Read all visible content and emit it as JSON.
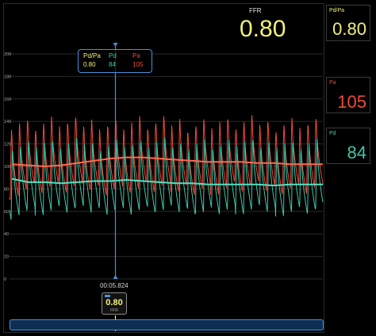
{
  "ffr": {
    "label": "FFR",
    "value": "0.80"
  },
  "panels": {
    "pdpa": {
      "label": "Pd/Pa",
      "value": "0.80",
      "color": "#f3f07a"
    },
    "pa": {
      "label": "Pa",
      "value": "105",
      "color": "#f04a3a"
    },
    "pd": {
      "label": "Pd",
      "value": "84",
      "color": "#3ec8a8"
    }
  },
  "tooltip": {
    "pdpa_label": "Pd/Pa",
    "pdpa_value": "0.80",
    "pd_label": "Pd",
    "pd_value": "84",
    "pa_label": "Pa",
    "pa_value": "105"
  },
  "cursor": {
    "time": "00:05.824",
    "badge_value": "0.80",
    "badge_label": "FFR"
  },
  "colors": {
    "pa": "#f04a3a",
    "pd": "#3ec8a8",
    "pa_mean": "#ff6a50",
    "pd_mean": "#55e0c2",
    "ffr": "#f3f07a",
    "accent": "#4a90d9"
  },
  "chart_data": {
    "type": "line",
    "y_ticks": [
      "200",
      "180",
      "160",
      "140",
      "120",
      "100",
      "80",
      "60",
      "40",
      "20",
      "0"
    ],
    "ylim": [
      0,
      200
    ],
    "grid": true,
    "series": [
      {
        "name": "Pa",
        "key": "pa_wave",
        "min": 80,
        "max": 140
      },
      {
        "name": "Pd",
        "key": "pd_wave",
        "min": 60,
        "max": 122
      },
      {
        "name": "Pa",
        "key": "pa_mean",
        "values": [
          102,
          101,
          100,
          101,
          103,
          105,
          107,
          108,
          108,
          107,
          106,
          105,
          104,
          104,
          104,
          103,
          103,
          102,
          102,
          102
        ]
      },
      {
        "name": "Pd",
        "key": "pd_mean",
        "values": [
          89,
          86,
          86,
          85,
          86,
          87,
          87,
          88,
          87,
          86,
          85,
          85,
          84,
          84,
          84,
          84,
          83,
          84,
          84,
          84
        ]
      }
    ]
  }
}
